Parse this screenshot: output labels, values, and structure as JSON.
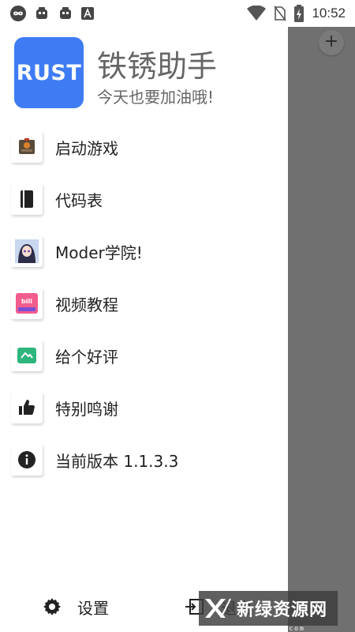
{
  "status_bar": {
    "time": "10:52",
    "left_icons": [
      "infinity-icon",
      "bug-icon",
      "bug-icon",
      "a-box-icon"
    ],
    "right_icons": [
      "wifi-icon",
      "no-sim-icon",
      "battery-charging-icon"
    ]
  },
  "fab": {
    "label": "+"
  },
  "header": {
    "logo_text": "RUST",
    "title": "铁锈助手",
    "subtitle": "今天也要加油哦!"
  },
  "menu": {
    "items": [
      {
        "label": "启动游戏",
        "icon": "game-launch-icon"
      },
      {
        "label": "代码表",
        "icon": "book-icon"
      },
      {
        "label": "Moder学院!",
        "icon": "anime-avatar-icon"
      },
      {
        "label": "视频教程",
        "icon": "bilibili-icon"
      },
      {
        "label": "给个好评",
        "icon": "rate-app-icon"
      },
      {
        "label": "特别鸣谢",
        "icon": "thumbs-up-icon"
      },
      {
        "label": "当前版本 1.1.3.3",
        "icon": "info-icon"
      }
    ]
  },
  "bottom": {
    "settings_label": "设置",
    "exit_label": "退出"
  },
  "watermark": {
    "text": "新绿资源网",
    "url": "www.xlhs.com"
  },
  "colors": {
    "logo_bg": "#3f7cf4",
    "overlay": "#707070",
    "review_green": "#2eb67d",
    "bilibili_pink": "#f25d8e"
  }
}
